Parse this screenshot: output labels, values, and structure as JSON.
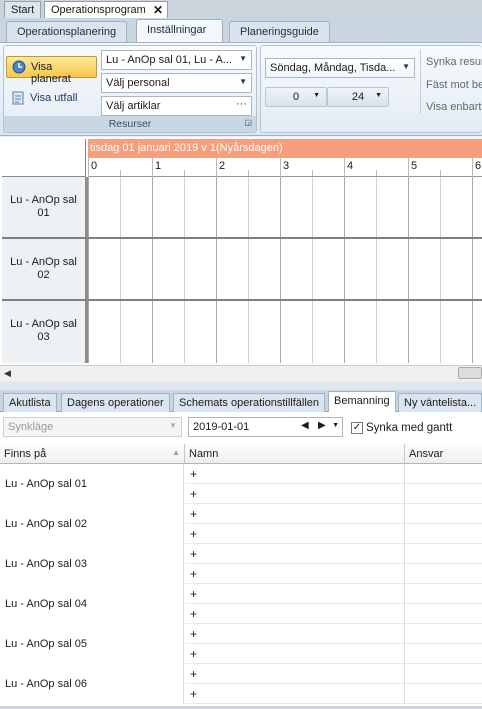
{
  "top_tabs": [
    {
      "label": "Start"
    },
    {
      "label": "Operationsprogram"
    }
  ],
  "top_tab_close": "✕",
  "ribbon_tabs": [
    {
      "label": "Operationsplanering"
    },
    {
      "label": "Inställningar"
    },
    {
      "label": "Planeringsguide"
    }
  ],
  "ribbon": {
    "visa_planerat": "Visa planerat",
    "visa_utfall": "Visa utfall",
    "resource_combo": "Lu - AnOp sal 01, Lu - A...",
    "personal_combo": "Välj personal",
    "artiklar_combo": "Välj artiklar",
    "artiklar_more": "···",
    "group_label": "Resurser",
    "days_combo": "Söndag, Måndag, Tisda...",
    "from_hour": "0",
    "to_hour": "24",
    "synka": "Synka resur",
    "fast": "Fäst mot be",
    "visa_enbart": "Visa enbart"
  },
  "gantt": {
    "date_header": "tisdag 01 januari 2019 v 1(Nyårsdagen)",
    "hours": [
      "0",
      "1",
      "2",
      "3",
      "4",
      "5",
      "6"
    ],
    "resources": [
      {
        "line1": "Lu - AnOp sal",
        "line2": "01"
      },
      {
        "line1": "Lu - AnOp sal",
        "line2": "02"
      },
      {
        "line1": "Lu - AnOp sal",
        "line2": "03"
      }
    ]
  },
  "bottom_tabs": [
    {
      "label": "Akutlista"
    },
    {
      "label": "Dagens operationer"
    },
    {
      "label": "Schemats operationstillfällen"
    },
    {
      "label": "Bemanning"
    },
    {
      "label": "Ny väntelista..."
    }
  ],
  "toolbar": {
    "sync_mode_placeholder": "Synkläge",
    "date_value": "2019-01-01",
    "sync_gantt_label": "Synka med gantt",
    "sync_gantt_checked": true
  },
  "table": {
    "headers": [
      "Finns på",
      "Namn",
      "Ansvar"
    ],
    "rows": [
      {
        "name": "Lu - AnOp sal 01",
        "subs": [
          "+",
          "+"
        ]
      },
      {
        "name": "Lu - AnOp sal 02",
        "subs": [
          "+",
          "+"
        ]
      },
      {
        "name": "Lu - AnOp sal 03",
        "subs": [
          "+",
          "+"
        ]
      },
      {
        "name": "Lu - AnOp sal 04",
        "subs": [
          "+",
          "+"
        ]
      },
      {
        "name": "Lu - AnOp sal 05",
        "subs": [
          "+",
          "+"
        ]
      },
      {
        "name": "Lu - AnOp sal 06",
        "subs": [
          "+",
          "+"
        ]
      }
    ]
  },
  "colors": {
    "date_header_bg": "#f79e7c",
    "selected_button": "#f7c64c"
  },
  "icons": [
    "clock-icon",
    "document-icon",
    "dropdown-arrow-icon",
    "sort-asc-icon",
    "scroll-left-icon",
    "calendar-prev-icon",
    "calendar-next-icon",
    "checkbox-icon"
  ]
}
